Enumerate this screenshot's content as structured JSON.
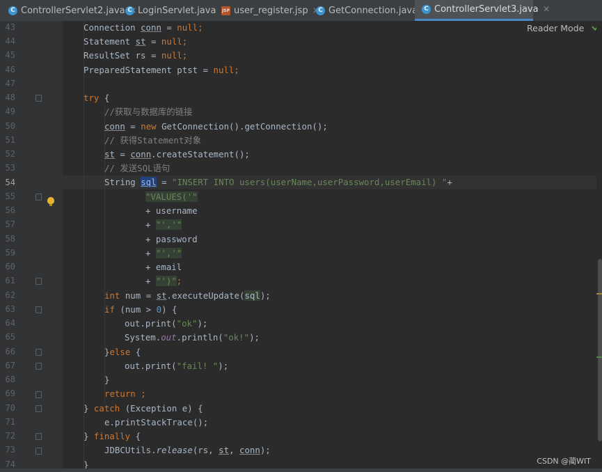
{
  "tabs": [
    {
      "label": "ControllerServlet2.java",
      "type": "java",
      "active": false
    },
    {
      "label": "LoginServlet.java",
      "type": "java",
      "active": false
    },
    {
      "label": "user_register.jsp",
      "type": "jsp",
      "active": false
    },
    {
      "label": "GetConnection.java",
      "type": "java",
      "active": false
    },
    {
      "label": "ControllerServlet3.java",
      "type": "java",
      "active": true
    }
  ],
  "tab_icons": {
    "java": "C",
    "jsp": "JSP"
  },
  "editor": {
    "reader_mode_label": "Reader Mode",
    "current_line": 54,
    "line_numbers": [
      "43",
      "44",
      "45",
      "46",
      "47",
      "48",
      "49",
      "50",
      "51",
      "52",
      "53",
      "54",
      "55",
      "56",
      "57",
      "58",
      "59",
      "60",
      "61",
      "62",
      "63",
      "64",
      "65",
      "66",
      "67",
      "68",
      "69",
      "70",
      "71",
      "72",
      "73",
      "74"
    ],
    "code": {
      "l43": {
        "a": "Connection ",
        "b": "conn",
        "c": " = ",
        "d": "null",
        "e": ";"
      },
      "l44": {
        "a": "Statement ",
        "b": "st",
        "c": " = ",
        "d": "null",
        "e": ";"
      },
      "l45": {
        "a": "ResultSet rs = ",
        "d": "null",
        "e": ";"
      },
      "l46": {
        "a": "PreparedStatement ptst = ",
        "d": "null",
        "e": ";"
      },
      "l48": {
        "a": "try",
        "b": " {"
      },
      "l49": {
        "a": "//获取与数据库的链接"
      },
      "l50": {
        "a": "conn",
        "b": " = ",
        "c": "new",
        "d": " GetConnection().getConnection();"
      },
      "l51": {
        "a": "// 获得Statement对象"
      },
      "l52": {
        "a": "st",
        "b": " = ",
        "c": "conn",
        "d": ".createStatement();"
      },
      "l53": {
        "a": "// 发送SQL语句"
      },
      "l54": {
        "a": "String ",
        "b": "sql",
        "c": " = ",
        "d": "\"INSERT INTO users(userName,userPassword,userEmail) \"",
        "e": "+"
      },
      "l55": {
        "a": "\"VALUES('\""
      },
      "l56": {
        "a": "+ username"
      },
      "l57": {
        "a": "+ ",
        "b": "\"','\""
      },
      "l58": {
        "a": "+ password"
      },
      "l59": {
        "a": "+ ",
        "b": "\"','\""
      },
      "l60": {
        "a": "+ email"
      },
      "l61": {
        "a": "+ ",
        "b": "\"')\"",
        "c": ";"
      },
      "l62": {
        "a": "int",
        "b": " num = ",
        "c": "st",
        "d": ".executeUpdate(",
        "e": "sql",
        "f": ");"
      },
      "l63": {
        "a": "if",
        "b": " (num > ",
        "c": "0",
        "d": ") {"
      },
      "l64": {
        "a": "out.print(",
        "b": "\"ok\"",
        "c": ");"
      },
      "l65": {
        "a": "System.",
        "b": "out",
        "c": ".println(",
        "d": "\"ok!\"",
        "e": ");"
      },
      "l66": {
        "a": "}",
        "b": "else",
        "c": " {"
      },
      "l67": {
        "a": "out.print(",
        "b": "\"fail! \"",
        "c": ");"
      },
      "l68": {
        "a": "}"
      },
      "l69": {
        "a": "return",
        "b": " ;"
      },
      "l70": {
        "a": "} ",
        "b": "catch",
        "c": " (Exception e) {"
      },
      "l71": {
        "a": "e.printStackTrace();"
      },
      "l72": {
        "a": "} ",
        "b": "finally",
        "c": " {"
      },
      "l73": {
        "a": "JDBCUtils.",
        "b": "release",
        "c": "(rs, ",
        "d": "st",
        "e": ", ",
        "f": "conn",
        "g": ");"
      },
      "l74": {
        "a": "}"
      }
    }
  },
  "watermark": "CSDN @蔺WIT",
  "colors": {
    "background": "#2b2b2b",
    "keyword": "#cc7832",
    "string": "#6a8759",
    "number": "#6897bb",
    "comment": "#808080",
    "field": "#9876aa",
    "active_tab_underline": "#4a88c7"
  }
}
